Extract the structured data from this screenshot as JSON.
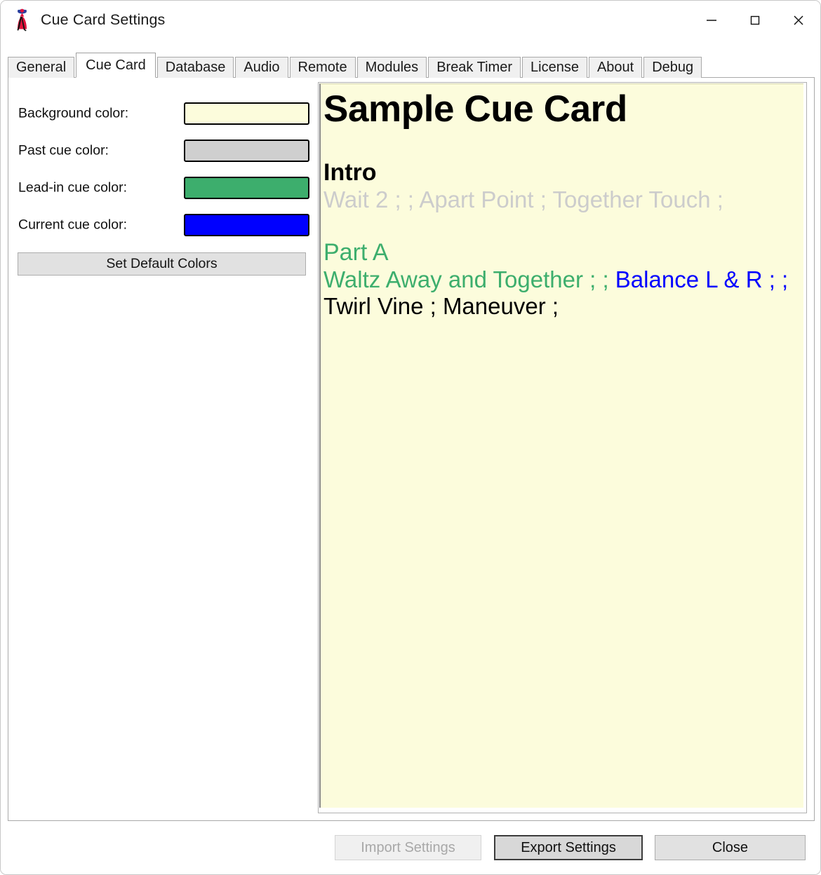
{
  "window": {
    "title": "Cue Card Settings",
    "icon": "dancer-icon",
    "minimize_label": "—",
    "maximize_label": "□",
    "close_label": "✕"
  },
  "tabs": [
    {
      "label": "General",
      "selected": false
    },
    {
      "label": "Cue Card",
      "selected": true
    },
    {
      "label": "Database",
      "selected": false
    },
    {
      "label": "Audio",
      "selected": false
    },
    {
      "label": "Remote",
      "selected": false
    },
    {
      "label": "Modules",
      "selected": false
    },
    {
      "label": "Break Timer",
      "selected": false
    },
    {
      "label": "License",
      "selected": false
    },
    {
      "label": "About",
      "selected": false
    },
    {
      "label": "Debug",
      "selected": false
    }
  ],
  "settings": {
    "color_rows": [
      {
        "label": "Background color:",
        "color": "#fcfcdc"
      },
      {
        "label": "Past cue color:",
        "color": "#cfcfcf"
      },
      {
        "label": "Lead-in cue color:",
        "color": "#3dae6d"
      },
      {
        "label": "Current cue color:",
        "color": "#0000ff"
      }
    ],
    "default_colors_button": "Set Default Colors"
  },
  "cue_card": {
    "background": "#fcfcdc",
    "title": "Sample Cue Card",
    "sections": [
      {
        "heading": "Intro",
        "heading_color": "#000000",
        "lines": [
          {
            "text": "Wait 2 ; ; Apart Point ; Together Touch ;",
            "color": "#cccccc",
            "state": "past"
          }
        ]
      },
      {
        "heading": "Part A",
        "heading_color": "#3dae6d",
        "lines": [
          {
            "segments": [
              {
                "text": "Waltz Away and Together ; ; ",
                "color": "#3dae6d",
                "state": "lead-in"
              },
              {
                "text": "Balance L & R ; ;",
                "color": "#0000ff",
                "state": "current"
              }
            ]
          },
          {
            "text": "Twirl Vine ; Maneuver ;",
            "color": "#000000",
            "state": "future"
          }
        ]
      }
    ]
  },
  "footer": {
    "import_label": "Import Settings",
    "export_label": "Export Settings",
    "close_label": "Close"
  }
}
